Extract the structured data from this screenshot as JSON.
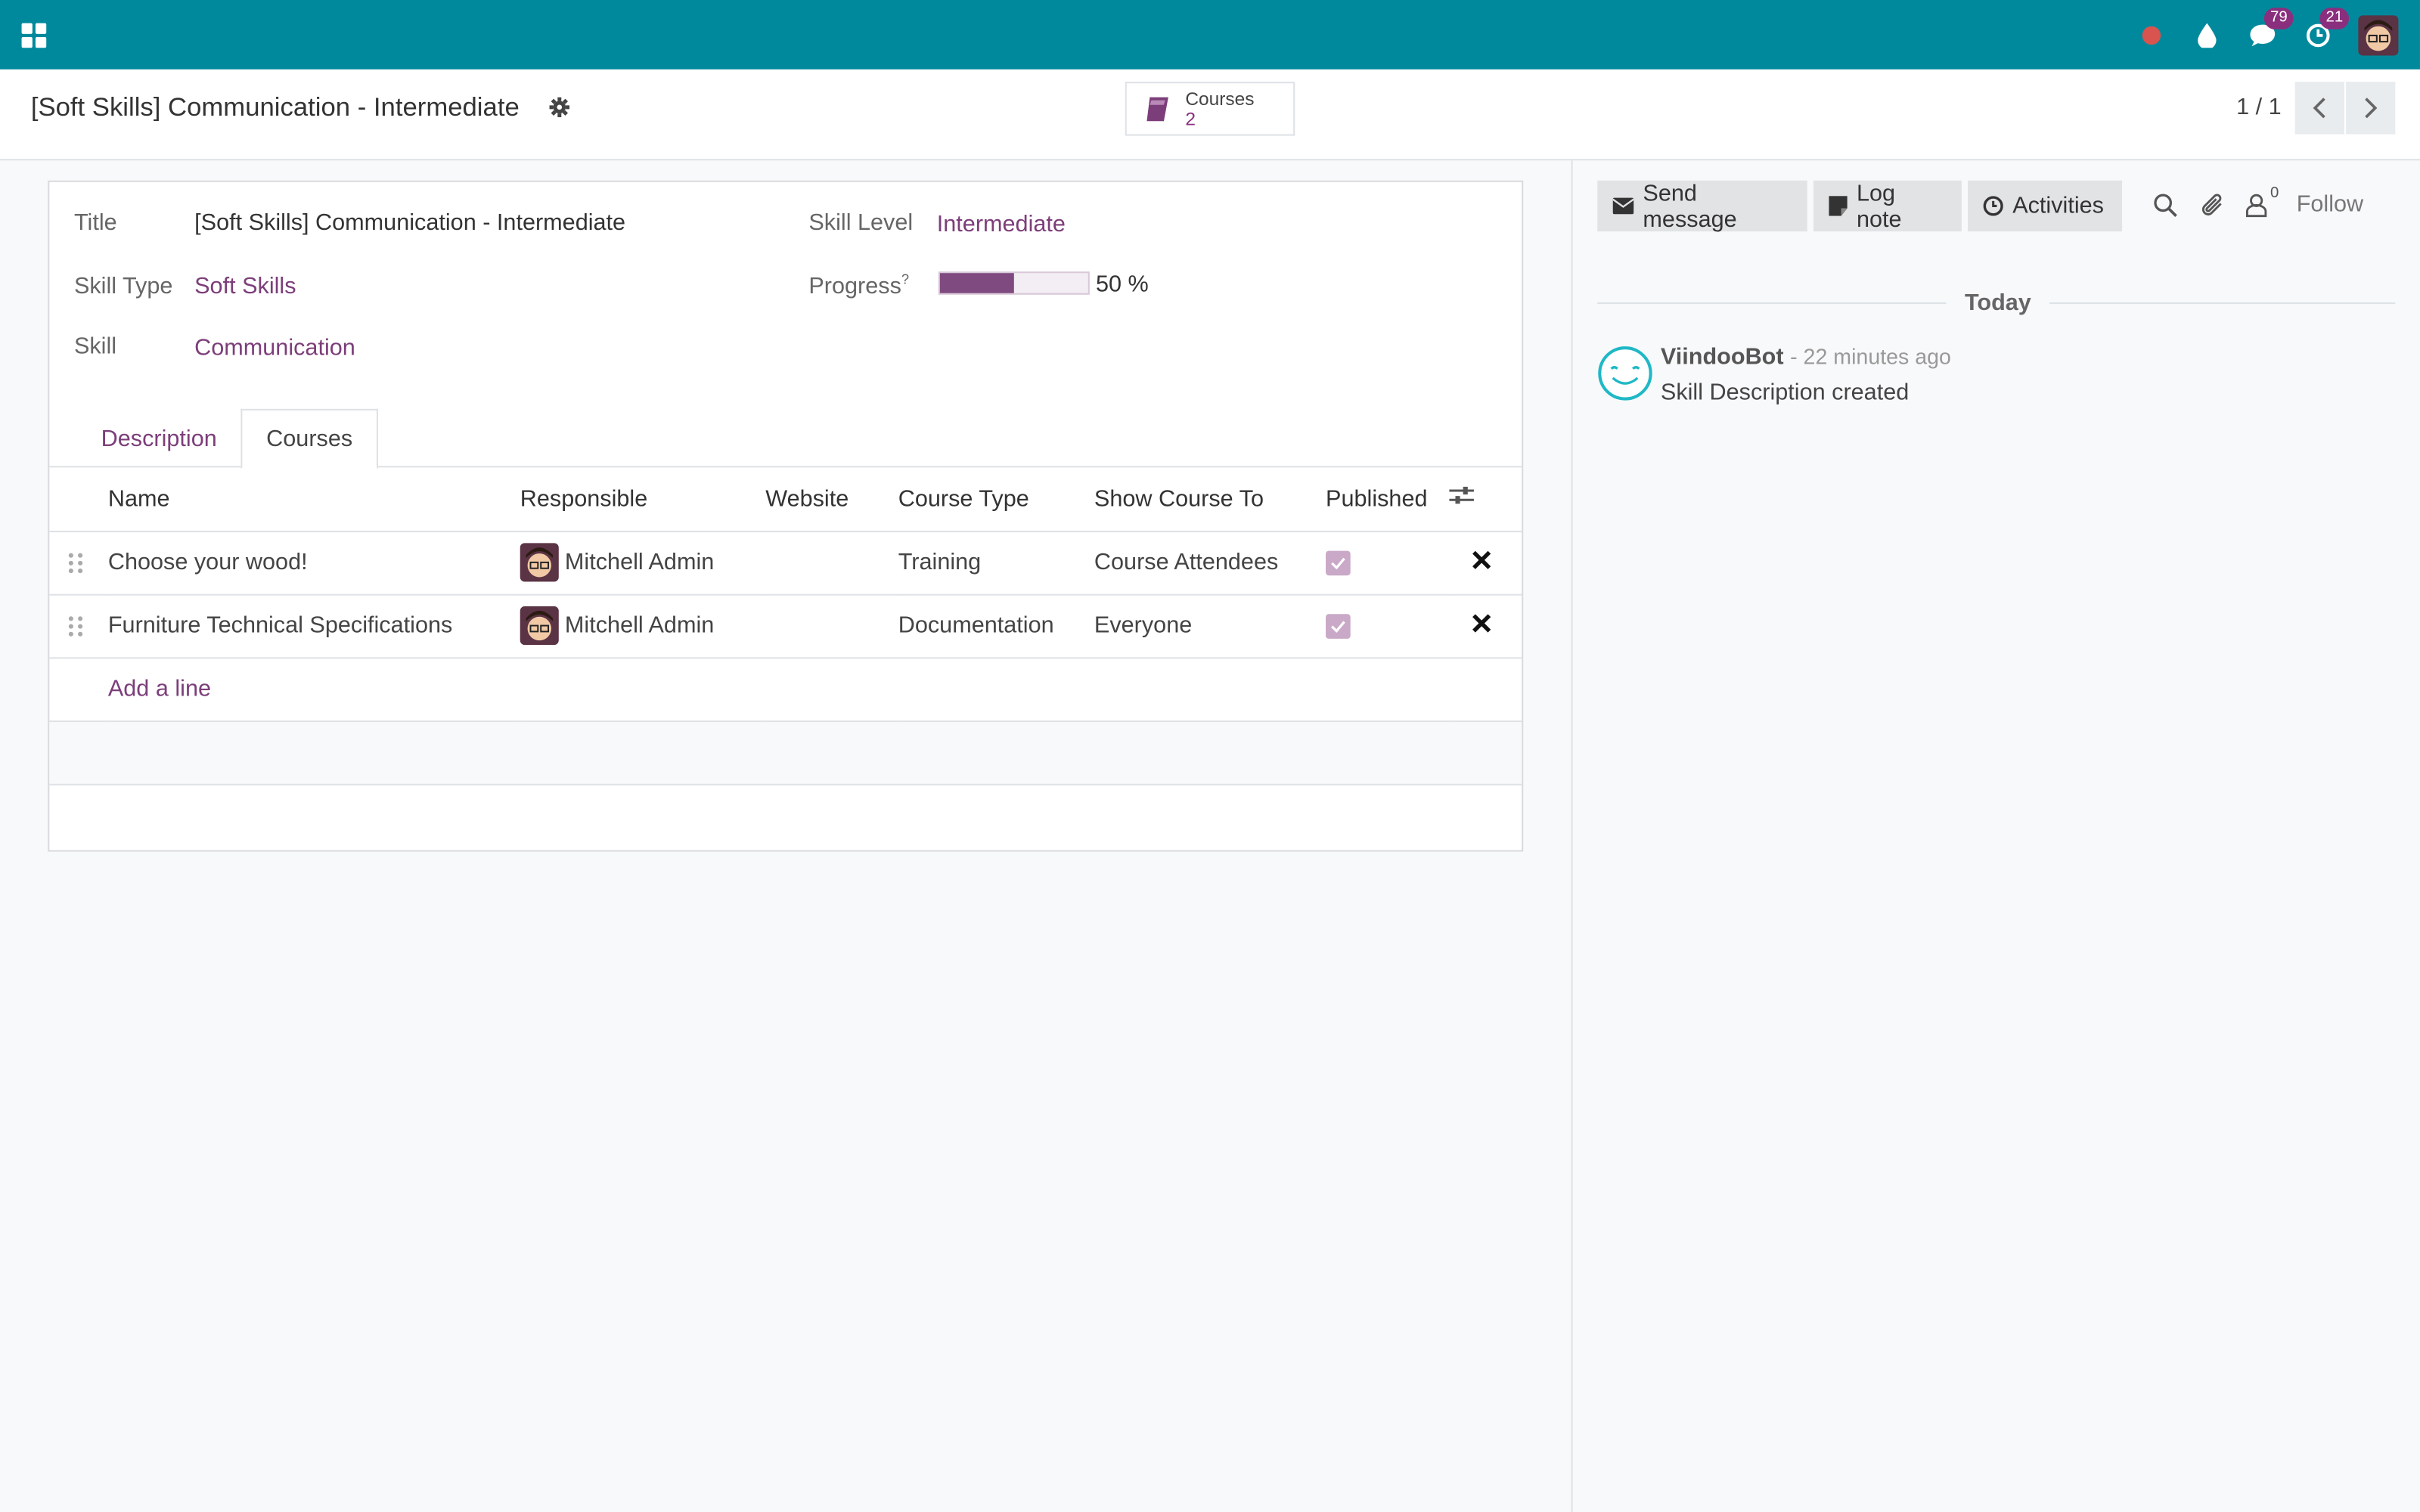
{
  "navbar": {
    "badges": {
      "messages": "79",
      "activities": "21"
    }
  },
  "record": {
    "title": "[Soft Skills] Communication - Intermediate",
    "smart_button": {
      "label": "Courses",
      "value": "2"
    },
    "pager": "1 / 1"
  },
  "fields": {
    "title_label": "Title",
    "title_value": "[Soft Skills] Communication - Intermediate",
    "skill_type_label": "Skill Type",
    "skill_type_value": "Soft Skills",
    "skill_label": "Skill",
    "skill_value": "Communication",
    "skill_level_label": "Skill Level",
    "skill_level_value": "Intermediate",
    "progress_label": "Progress",
    "progress_help": "?",
    "progress_value": 50,
    "progress_text": "50 %"
  },
  "tabs": {
    "description": "Description",
    "courses": "Courses"
  },
  "courses_table": {
    "columns": [
      "Name",
      "Responsible",
      "Website",
      "Course Type",
      "Show Course To",
      "Published"
    ],
    "rows": [
      {
        "name": "Choose your wood!",
        "responsible": "Mitchell Admin",
        "website": "",
        "course_type": "Training",
        "show_to": "Course Attendees",
        "published": true
      },
      {
        "name": "Furniture Technical Specifications",
        "responsible": "Mitchell Admin",
        "website": "",
        "course_type": "Documentation",
        "show_to": "Everyone",
        "published": true
      }
    ],
    "add_line": "Add a line"
  },
  "chatter": {
    "send_message": "Send message",
    "log_note": "Log note",
    "activities": "Activities",
    "followers_count": "0",
    "follow": "Follow",
    "date_separator": "Today",
    "message": {
      "author": "ViindooBot",
      "date": "- 22 minutes ago",
      "body": "Skill Description created"
    }
  },
  "colors": {
    "navbar": "#00899c",
    "accent": "#7c3e7a",
    "badge": "#8a2f7e"
  }
}
